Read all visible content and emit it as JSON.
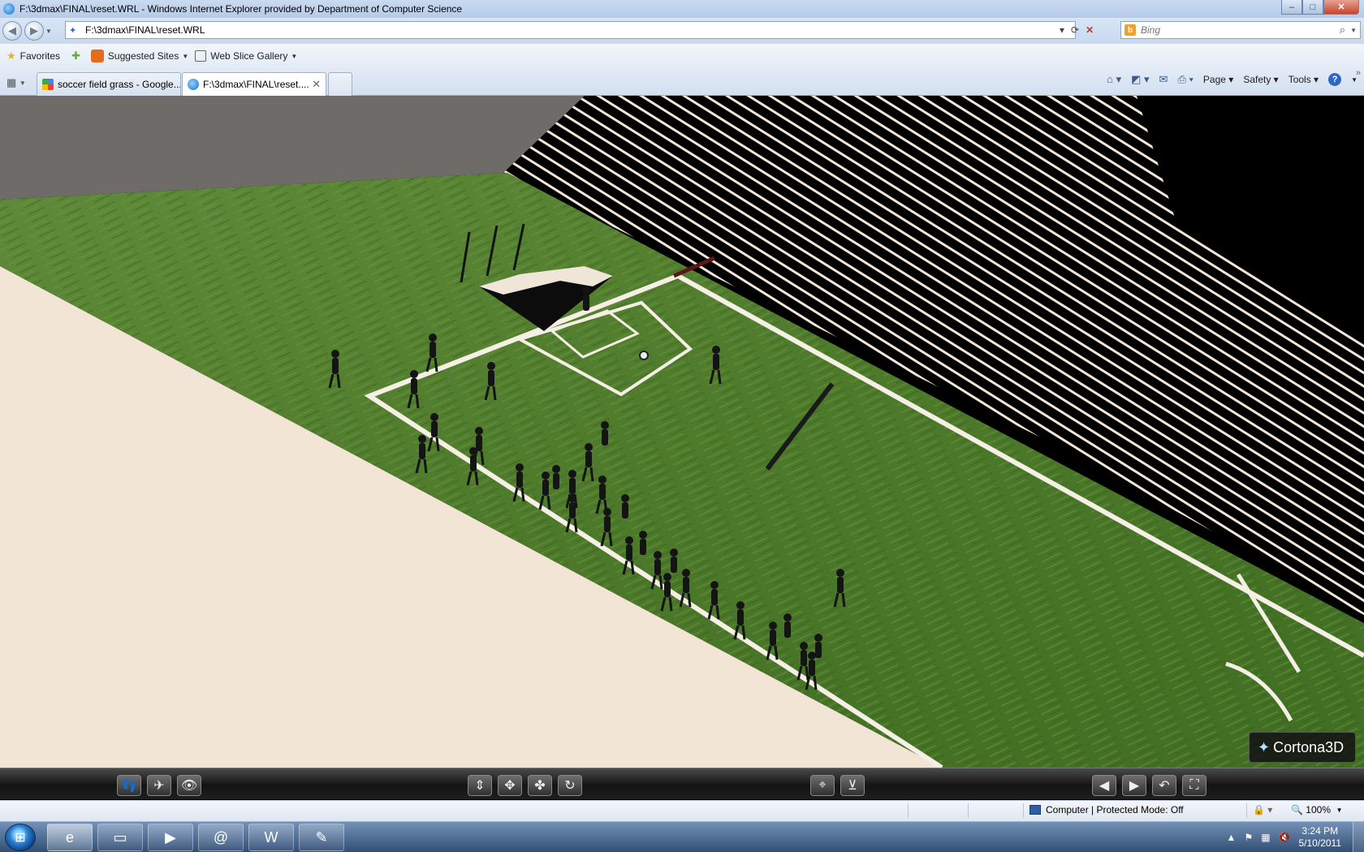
{
  "window": {
    "title": "F:\\3dmax\\FINAL\\reset.WRL - Windows Internet Explorer provided by Department of Computer Science",
    "controls": {
      "minimize": "–",
      "maximize": "□",
      "close": "✕"
    }
  },
  "address": {
    "url": "F:\\3dmax\\FINAL\\reset.WRL",
    "search_placeholder": "Bing"
  },
  "favorites": {
    "favorites_label": "Favorites",
    "items": [
      {
        "label": "Suggested Sites"
      },
      {
        "label": "Web Slice Gallery"
      }
    ]
  },
  "tabs": [
    {
      "label": "soccer field grass - Google..."
    },
    {
      "label": "F:\\3dmax\\FINAL\\reset...."
    }
  ],
  "commandbar": {
    "page_label": "Page",
    "safety_label": "Safety",
    "tools_label": "Tools"
  },
  "viewer": {
    "logo_text": "Cortona3D",
    "toolbar_icons": [
      "walk-icon",
      "fly-icon",
      "study-icon",
      "plan-icon",
      "pan-icon",
      "turn-icon",
      "roll-icon",
      "goto-icon",
      "align-icon",
      "previous-viewpoint-icon",
      "next-viewpoint-icon",
      "restore-icon",
      "fit-icon"
    ]
  },
  "status": {
    "zone": "Computer | Protected Mode: Off",
    "zoom": "100%"
  },
  "taskbar": {
    "apps": [
      "internet-explorer-icon",
      "explorer-folder-icon",
      "media-player-icon",
      "app-swirl-icon",
      "word-icon",
      "paint-icon"
    ],
    "time": "3:24 PM",
    "date": "5/10/2011"
  },
  "colors": {
    "grass": "#4f7d2c",
    "floor": "#f3e5d6",
    "stands": "#000000",
    "field_lines": "#f5efe6",
    "sky": "#6f6b68"
  }
}
